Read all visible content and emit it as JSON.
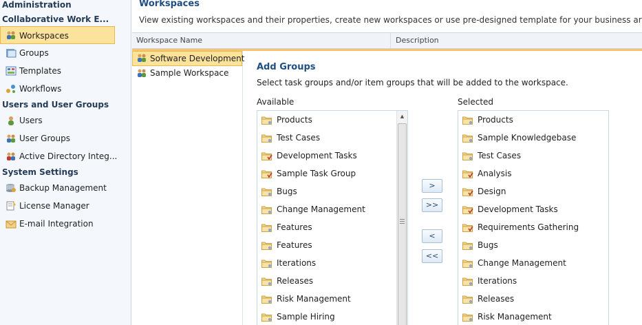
{
  "sidebar": {
    "sections": [
      {
        "title": "Administration",
        "items": []
      },
      {
        "title": "Collaborative Work E...",
        "items": [
          {
            "label": "Workspaces",
            "icon": "workspaces-icon",
            "selected": true
          },
          {
            "label": "Groups",
            "icon": "groups-icon"
          },
          {
            "label": "Templates",
            "icon": "templates-icon"
          },
          {
            "label": "Workflows",
            "icon": "workflows-icon"
          }
        ]
      },
      {
        "title": "Users and User Groups",
        "items": [
          {
            "label": "Users",
            "icon": "user-icon"
          },
          {
            "label": "User Groups",
            "icon": "user-groups-icon"
          },
          {
            "label": "Active Directory Integ...",
            "icon": "active-directory-icon"
          }
        ]
      },
      {
        "title": "System Settings",
        "items": [
          {
            "label": "Backup Management",
            "icon": "backup-icon"
          },
          {
            "label": "License Manager",
            "icon": "license-icon"
          },
          {
            "label": "E-mail Integration",
            "icon": "email-icon"
          }
        ]
      }
    ]
  },
  "page": {
    "title": "Workspaces",
    "description": "View existing workspaces and their properties, create new workspaces or use pre-designed template for your business area."
  },
  "grid": {
    "columns": [
      "Workspace Name",
      "Description"
    ],
    "workspaces": [
      {
        "name": "Software Development",
        "selected": true
      },
      {
        "name": "Sample Workspace"
      }
    ]
  },
  "add_groups": {
    "title": "Add Groups",
    "description": "Select task groups and/or item groups that will be added to the workspace.",
    "available_label": "Available",
    "selected_label": "Selected",
    "available": [
      {
        "label": "Products",
        "type": "item"
      },
      {
        "label": "Test Cases",
        "type": "item"
      },
      {
        "label": "Development Tasks",
        "type": "task"
      },
      {
        "label": "Sample Task Group",
        "type": "task"
      },
      {
        "label": "Bugs",
        "type": "item"
      },
      {
        "label": "Change Management",
        "type": "item"
      },
      {
        "label": "Features",
        "type": "item"
      },
      {
        "label": "Features",
        "type": "item"
      },
      {
        "label": "Iterations",
        "type": "item"
      },
      {
        "label": "Releases",
        "type": "item"
      },
      {
        "label": "Risk Management",
        "type": "item"
      },
      {
        "label": "Sample Hiring",
        "type": "item"
      }
    ],
    "selected": [
      {
        "label": "Products",
        "type": "item"
      },
      {
        "label": "Sample Knowledgebase",
        "type": "item"
      },
      {
        "label": "Test Cases",
        "type": "item"
      },
      {
        "label": "Analysis",
        "type": "task"
      },
      {
        "label": "Design",
        "type": "task"
      },
      {
        "label": "Development Tasks",
        "type": "task"
      },
      {
        "label": "Requirements Gathering",
        "type": "task"
      },
      {
        "label": "Bugs",
        "type": "item"
      },
      {
        "label": "Change Management",
        "type": "item"
      },
      {
        "label": "Iterations",
        "type": "item"
      },
      {
        "label": "Releases",
        "type": "item"
      },
      {
        "label": "Risk Management",
        "type": "item"
      }
    ],
    "buttons": {
      "add": ">",
      "add_all": ">>",
      "remove": "<",
      "remove_all": "<<"
    }
  },
  "colors": {
    "selection": "#fbe39c",
    "selection_border": "#e7b94e",
    "heading": "#1f4e83",
    "accent_line": "#f7c46a"
  }
}
